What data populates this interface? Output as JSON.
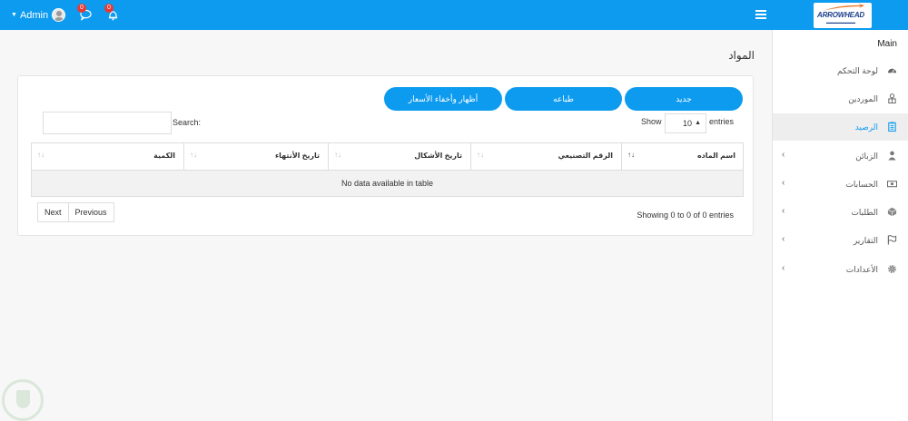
{
  "topbar": {
    "user": "Admin",
    "messages_count": "0",
    "alerts_count": "0",
    "logo_text": "ARROWHEAD"
  },
  "sidebar": {
    "heading": "Main",
    "items": [
      {
        "label": "لوحة التحكم",
        "icon": "dashboard-icon"
      },
      {
        "label": "الموردين",
        "icon": "user-tie-icon"
      },
      {
        "label": "الرصيد",
        "icon": "clipboard-icon",
        "active": true
      },
      {
        "label": "الزبائن",
        "icon": "user-icon",
        "expandable": true
      },
      {
        "label": "الحسابات",
        "icon": "money-icon",
        "expandable": true
      },
      {
        "label": "الطلبات",
        "icon": "cube-icon",
        "expandable": true
      },
      {
        "label": "التقارير",
        "icon": "flag-icon",
        "expandable": true
      },
      {
        "label": "الأعدادات",
        "icon": "gear-icon",
        "expandable": true
      }
    ]
  },
  "page": {
    "title": "المواد",
    "buttons": {
      "new": "جديد",
      "print": "طباعه",
      "toggle_prices": "أظهار وأخفاء الأسعار"
    },
    "show_label": "Show",
    "entries_label": "entries",
    "page_size": "10",
    "search_label": "Search:",
    "table": {
      "columns": [
        "اسم الماده",
        "الرقم التصنيعي",
        "تاريخ الأشكال",
        "تاريخ الأنتهاء",
        "الكمية"
      ],
      "empty_message": "No data available in table"
    },
    "info": "Showing 0 to 0 of 0 entries",
    "pagination": {
      "next": "Next",
      "previous": "Previous"
    }
  },
  "colors": {
    "primary": "#0d9bf0",
    "active_bg": "#eeeeee"
  }
}
